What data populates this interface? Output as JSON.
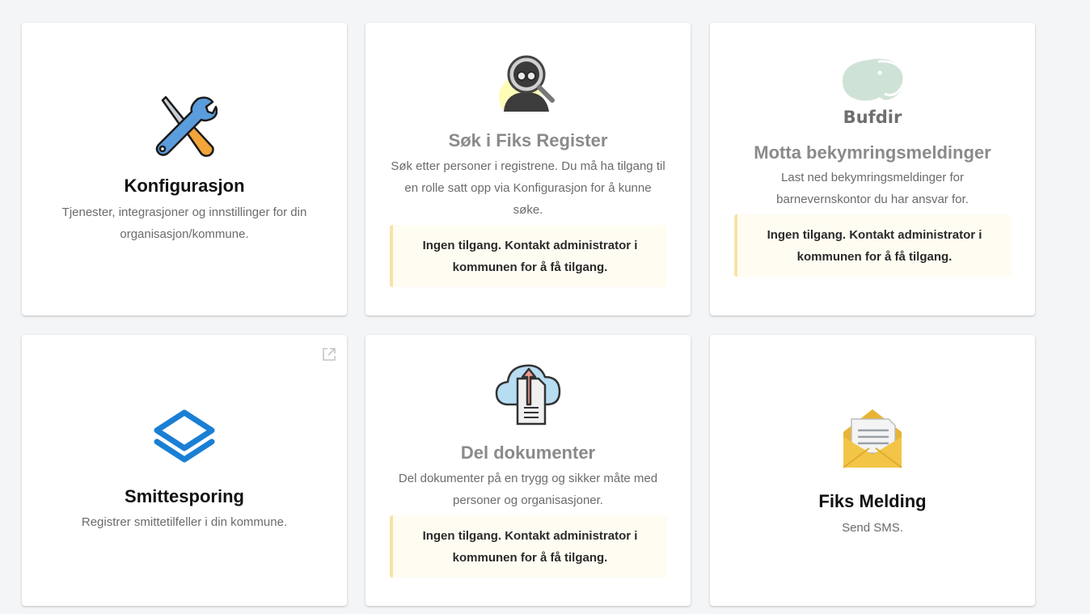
{
  "cards": [
    {
      "title": "Konfigurasjon",
      "description": "Tjenester, integrasjoner og innstillinger for din organisasjon/kommune.",
      "icon": "tools-icon"
    },
    {
      "title": "Søk i Fiks Register",
      "description": "Søk etter personer i registrene. Du må ha tilgang til en rolle satt opp via Konfigurasjon for å kunne søke.",
      "notice": "Ingen tilgang. Kontakt administrator i kommunen for å få tilgang.",
      "icon": "person-search-icon"
    },
    {
      "logo_text": "Bufdir",
      "title": "Motta bekymringsmeldinger",
      "description": "Last ned bekymringsmeldinger for barnevernskontor du har ansvar for.",
      "notice": "Ingen tilgang. Kontakt administrator i kommunen for å få tilgang.",
      "icon": "bufdir-logo"
    },
    {
      "title": "Smittesporing",
      "description": "Registrer smittetilfeller i din kommune.",
      "icon": "layers-icon",
      "external_link_icon": "open-in-new-icon"
    },
    {
      "title": "Del dokumenter",
      "description": "Del dokumenter på en trygg og sikker måte med personer og organisasjoner.",
      "notice": "Ingen tilgang. Kontakt administrator i kommunen for å få tilgang.",
      "icon": "cloud-upload-document-icon"
    },
    {
      "title": "Fiks Melding",
      "description": "Send SMS.",
      "icon": "envelope-letter-icon"
    }
  ],
  "colors": {
    "page_background": "#f4f5f7",
    "card_background": "#ffffff",
    "title": "#111111",
    "title_disabled": "#8a8a8a",
    "notice_background": "#fffcf2",
    "notice_border": "#f6e3a6",
    "smittesporing_blue": "#1a7fd4"
  }
}
